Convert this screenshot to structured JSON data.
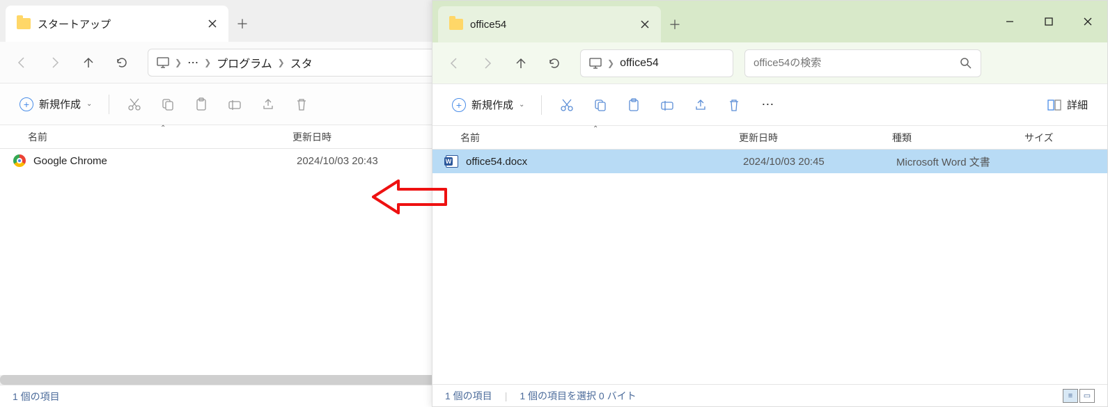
{
  "left": {
    "tab_title": "スタートアップ",
    "new_label": "新規作成",
    "breadcrumb": [
      "プログラム",
      "スタ"
    ],
    "ellipsis": "⋯",
    "columns": {
      "name": "名前",
      "date": "更新日時"
    },
    "files": [
      {
        "name": "Google Chrome",
        "date": "2024/10/03 20:43"
      }
    ],
    "status": "1 個の項目"
  },
  "right": {
    "tab_title": "office54",
    "new_label": "新規作成",
    "breadcrumb": [
      "office54"
    ],
    "search_placeholder": "office54の検索",
    "detail_label": "詳細",
    "columns": {
      "name": "名前",
      "date": "更新日時",
      "type": "種類",
      "size": "サイズ"
    },
    "files": [
      {
        "name": "office54.docx",
        "date": "2024/10/03 20:45",
        "type": "Microsoft Word 文書"
      }
    ],
    "status_items": "1 個の項目",
    "status_selected": "1 個の項目を選択  0 バイト"
  }
}
